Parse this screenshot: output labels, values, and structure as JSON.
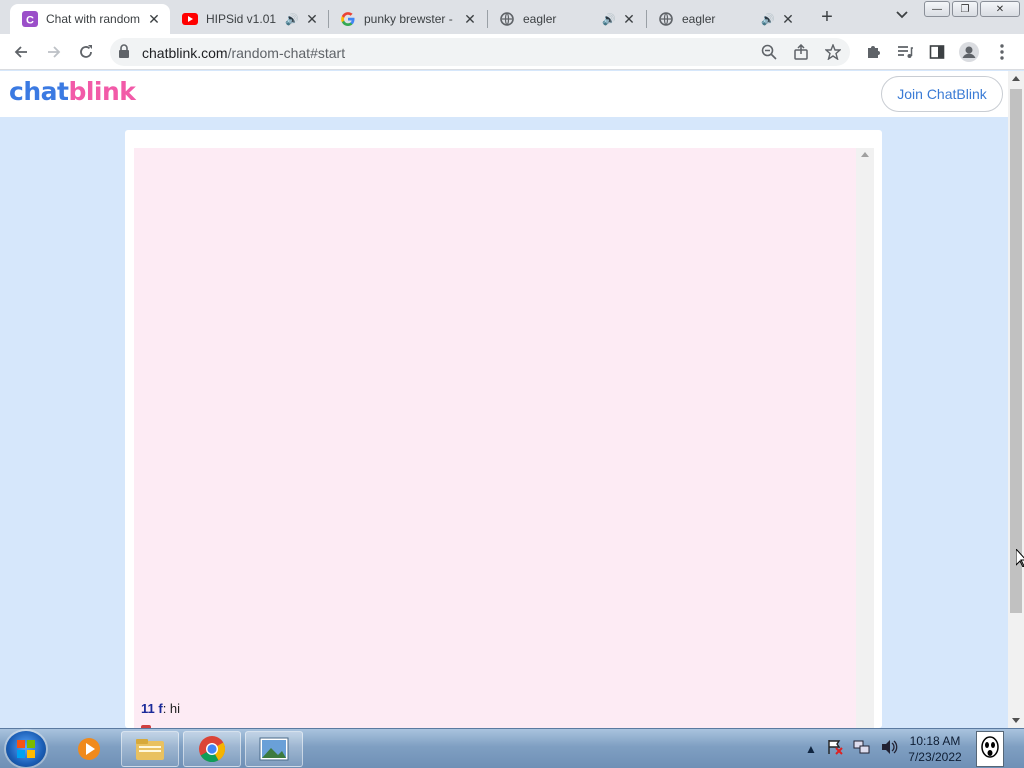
{
  "browser": {
    "tabs": [
      {
        "title": "Chat with random",
        "icon": "chatblink-favicon",
        "active": true
      },
      {
        "title": "HIPSid v1.01 (",
        "icon": "youtube-favicon",
        "audio": true
      },
      {
        "title": "punky brewster - ",
        "icon": "google-favicon"
      },
      {
        "title": "eagler",
        "icon": "globe-favicon",
        "audio": true
      },
      {
        "title": "eagler",
        "icon": "globe-favicon",
        "audio": true
      }
    ],
    "url_domain": "chatblink.com",
    "url_path": "/random-chat#start"
  },
  "site": {
    "logo_part1": "chat",
    "logo_part2": "blink",
    "join_label": "Join ChatBlink"
  },
  "chat": {
    "messages": [
      {
        "nick": "11 f",
        "text": ": hi"
      }
    ]
  },
  "taskbar": {
    "time": "10:18 AM",
    "date": "7/23/2022"
  },
  "colors": {
    "logo_blue": "#3b7ae2",
    "logo_pink": "#f25aa8",
    "page_bg": "#d6e7fb",
    "chat_bg": "#fdebf4"
  }
}
